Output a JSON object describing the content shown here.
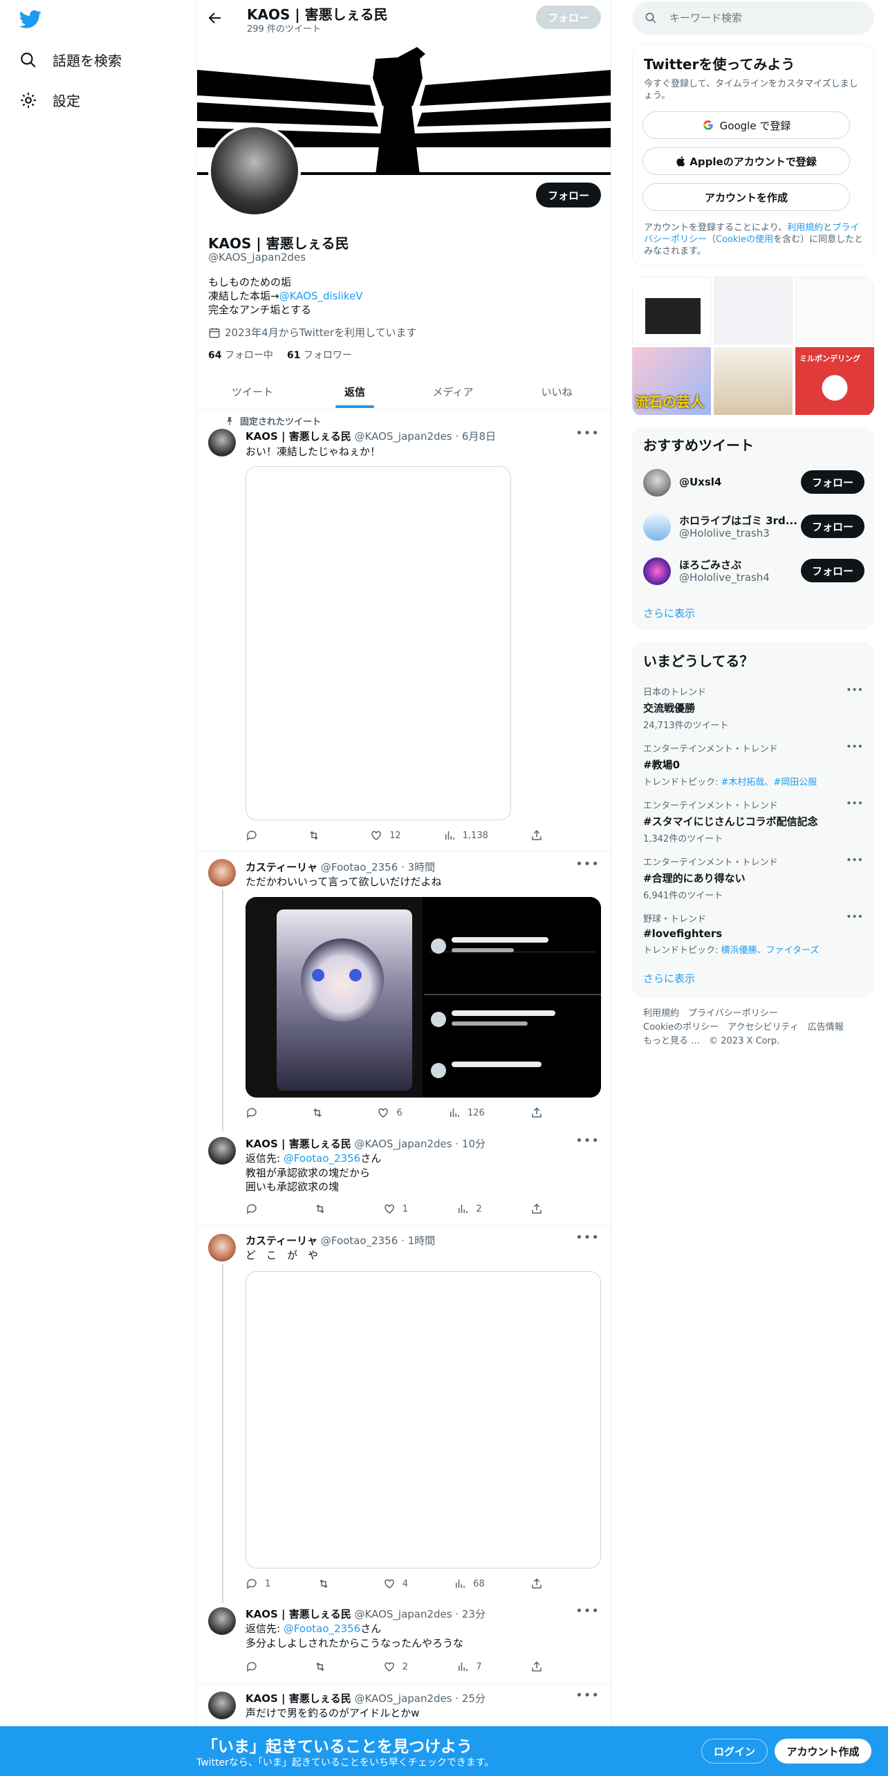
{
  "nav": {
    "explore_label": "話題を検索",
    "settings_label": "設定"
  },
  "header": {
    "title": "KAOS | 害悪しぇる民",
    "tweet_count": "299 件のツイート",
    "follow_label": "フォロー"
  },
  "profile": {
    "follow_label": "フォロー",
    "name": "KAOS | 害悪しぇる民",
    "handle": "@KAOS_japan2des",
    "bio_line1": "もしものための垢",
    "bio_line2_prefix": "凍結した本垢→",
    "bio_line2_link": "@KAOS_dislikeV",
    "bio_line3": "完全なアンチ垢とする",
    "joined": "2023年4月からTwitterを利用しています",
    "following_count": "64",
    "following_label": "フォロー中",
    "followers_count": "61",
    "followers_label": "フォロワー"
  },
  "tabs": [
    "ツイート",
    "返信",
    "メディア",
    "いいね"
  ],
  "active_tab": 1,
  "tweets": [
    {
      "pinned_label": "固定されたツイート",
      "name": "KAOS | 害悪しぇる民",
      "handle": "@KAOS_japan2des",
      "time": "· 6月8日",
      "text": "おい！凍結したじゃねぇか！",
      "replies": "",
      "retweets": "",
      "likes": "12",
      "views": "1,138"
    },
    {
      "name": "カスティーリャ",
      "handle": "@Footao_2356",
      "time": "· 3時間",
      "text": "ただかわいいって言って欲しいだけだよね",
      "replies": "",
      "retweets": "",
      "likes": "6",
      "views": "126"
    },
    {
      "name": "KAOS | 害悪しぇる民",
      "handle": "@KAOS_japan2des",
      "time": "· 10分",
      "reply_prefix": "返信先: ",
      "reply_to": "@Footao_2356",
      "reply_suffix": "さん",
      "text_line1": "教祖が承認欲求の塊だから",
      "text_line2": "囲いも承認欲求の塊",
      "replies": "",
      "retweets": "",
      "likes": "1",
      "views": "2"
    },
    {
      "name": "カスティーリャ",
      "handle": "@Footao_2356",
      "time": "· 1時間",
      "text": "ど　こ　が　や",
      "replies": "1",
      "retweets": "",
      "likes": "4",
      "views": "68"
    },
    {
      "name": "KAOS | 害悪しぇる民",
      "handle": "@KAOS_japan2des",
      "time": "· 23分",
      "reply_prefix": "返信先: ",
      "reply_to": "@Footao_2356",
      "reply_suffix": "さん",
      "text": "多分よしよしされたからこうなったんやろうな",
      "replies": "",
      "retweets": "",
      "likes": "2",
      "views": "7"
    },
    {
      "name": "KAOS | 害悪しぇる民",
      "handle": "@KAOS_japan2des",
      "time": "· 25分",
      "text": "声だけで男を釣るのがアイドルとかw"
    }
  ],
  "search": {
    "placeholder": "キーワード検索"
  },
  "signup": {
    "title": "Twitterを使ってみよう",
    "subtitle": "今すぐ登録して、タイムラインをカスタマイズしましょう。",
    "google_label": "Google で登録",
    "apple_label": "Appleのアカウントで登録",
    "create_label": "アカウントを作成",
    "terms_prefix": "アカウントを登録することにより、",
    "terms_link1": "利用規約",
    "terms_mid": "と",
    "terms_link2": "プライバシーポリシー",
    "terms_paren_open": "（",
    "terms_link3": "Cookieの使用",
    "terms_suffix": "を含む）に同意したとみなされます。"
  },
  "media_grid_caption": "流石の芸人",
  "media_grid_caption2": "ミルポンデリング",
  "recommended": {
    "title": "おすすめツイート",
    "accounts": [
      {
        "name": "@Uxsl4",
        "handle": "",
        "follow_label": "フォロー"
      },
      {
        "name": "ホロライブはゴミ 3rd...",
        "handle": "@Hololive_trash3",
        "follow_label": "フォロー"
      },
      {
        "name": "ほろごみさぶ",
        "handle": "@Hololive_trash4",
        "follow_label": "フォロー"
      }
    ],
    "show_more": "さらに表示"
  },
  "trends": {
    "title": "いまどうしてる？",
    "items": [
      {
        "meta": "日本のトレンド",
        "name": "交流戦優勝",
        "sub": "24,713件のツイート"
      },
      {
        "meta": "エンターテインメント・トレンド",
        "name": "#教場0",
        "sub_prefix": "トレンドトピック: ",
        "sub_links": "#木村拓哉、#岡田公服"
      },
      {
        "meta": "エンターテインメント・トレンド",
        "name": "#スタマイにじさんじコラボ配信記念",
        "sub": "1,342件のツイート"
      },
      {
        "meta": "エンターテインメント・トレンド",
        "name": "#合理的にあり得ない",
        "sub": "6,941件のツイート"
      },
      {
        "meta": "野球・トレンド",
        "name": "#lovefighters",
        "sub_prefix": "トレンドトピック: ",
        "sub_links": "横浜優勝、ファイターズ"
      }
    ],
    "show_more": "さらに表示"
  },
  "footer": {
    "line1": "利用規約　プライバシーポリシー",
    "line2": "Cookieのポリシー　アクセシビリティ　広告情報",
    "line3": "もっと見る …　© 2023 X Corp."
  },
  "banner": {
    "title": "「いま」起きていることを見つけよう",
    "subtitle": "Twitterなら、「いま」起きていることをいち早くチェックできます。",
    "login_label": "ログイン",
    "signup_label": "アカウント作成"
  },
  "colors": {
    "accent": "#1d9bf0",
    "text": "#0f1419",
    "muted": "#536471",
    "panel": "#f7f9f9"
  }
}
